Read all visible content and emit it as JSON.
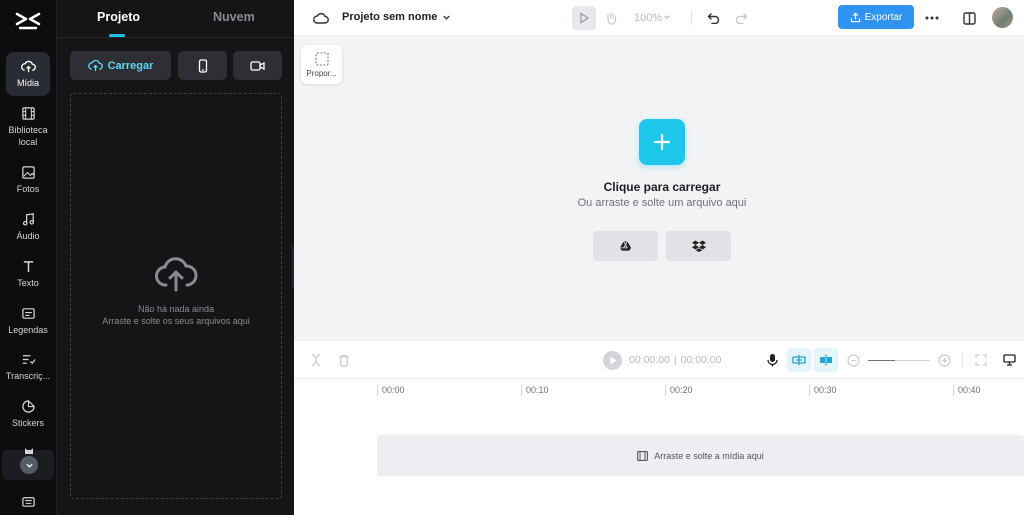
{
  "sidebar": {
    "items": [
      {
        "label": "Mídia",
        "icon": "cloud-upload-icon"
      },
      {
        "label": "Biblioteca local",
        "icon": "film-icon"
      },
      {
        "label": "Fotos",
        "icon": "image-icon"
      },
      {
        "label": "Áudio",
        "icon": "music-note-icon"
      },
      {
        "label": "Texto",
        "icon": "text-icon"
      },
      {
        "label": "Legendas",
        "icon": "captions-icon"
      },
      {
        "label": "Transcriç...",
        "icon": "transcript-icon"
      },
      {
        "label": "Stickers",
        "icon": "sticker-icon"
      }
    ]
  },
  "panel": {
    "tabs": [
      {
        "label": "Projeto"
      },
      {
        "label": "Nuvem"
      }
    ],
    "upload_label": "Carregar",
    "empty_title": "Não há nada ainda",
    "empty_sub": "Arraste e solte os seus arquivos aqui"
  },
  "header": {
    "project_name": "Projeto sem nome",
    "zoom": "100%",
    "export_label": "Exportar"
  },
  "canvas": {
    "ratio_label": "Propor...",
    "upload_title": "Clique para carregar",
    "upload_sub": "Ou arraste e solte um arquivo aqui"
  },
  "timeline": {
    "current_time": "00:00:00",
    "total_time": "00:00:00",
    "separator": "|",
    "ticks": [
      "00:00",
      "00:10",
      "00:20",
      "00:30",
      "00:40"
    ],
    "drop_label": "Arraste e solte a mídia aqui"
  },
  "colors": {
    "accent": "#1ec6ea",
    "export": "#2f94f0",
    "rail_bg": "#0d0d0f",
    "panel_bg": "#151518"
  }
}
